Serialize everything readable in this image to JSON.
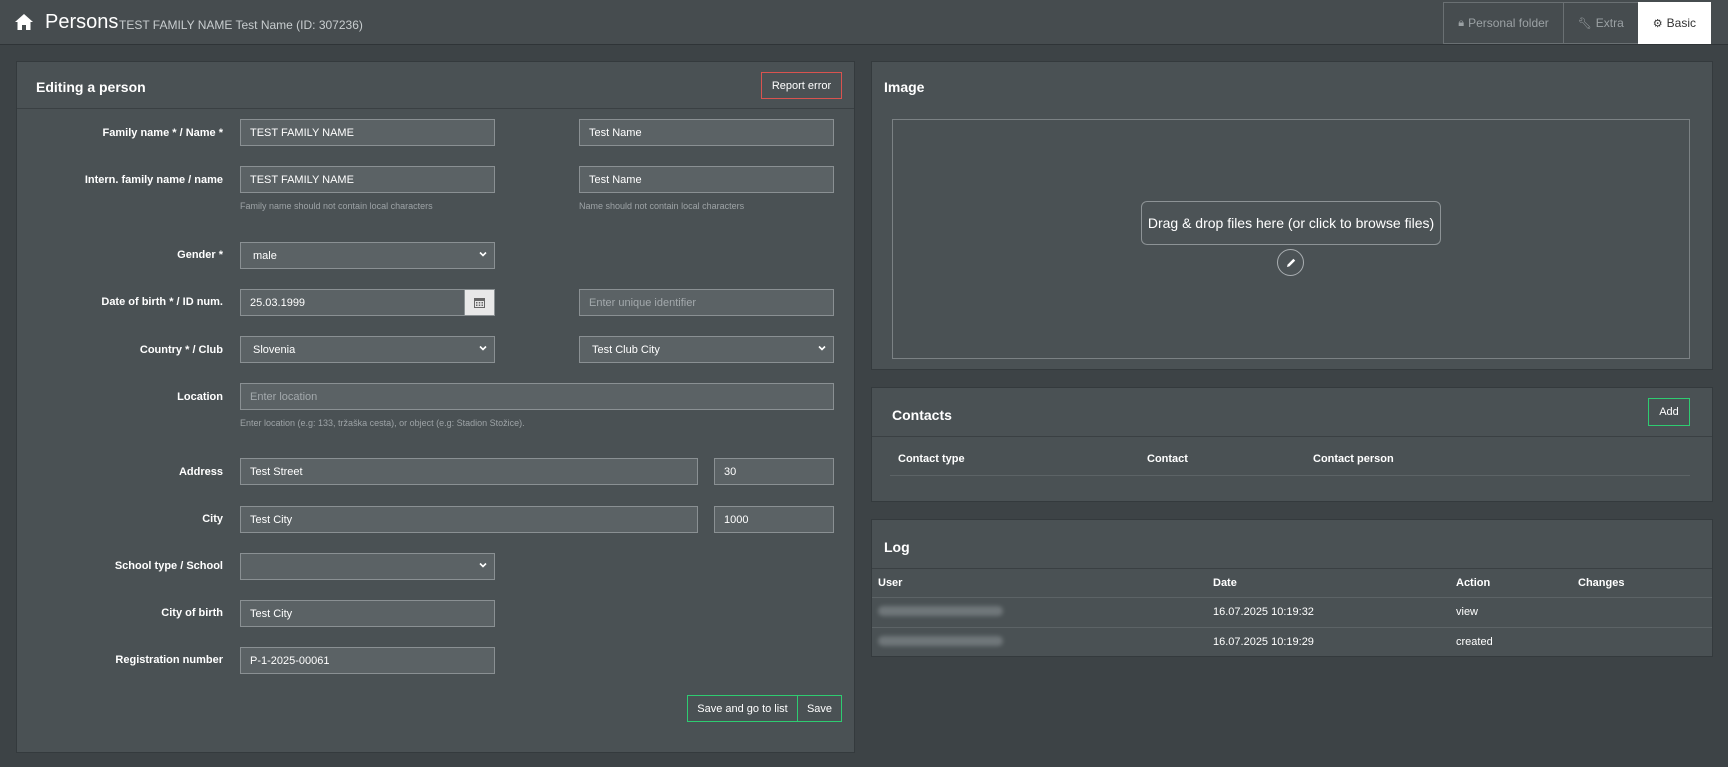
{
  "header": {
    "title": "Persons",
    "subtitle": "TEST FAMILY NAME Test Name (ID: 307236)",
    "tabs": [
      {
        "label": "Personal folder",
        "icon": "lock-icon",
        "active": false
      },
      {
        "label": "Extra",
        "icon": "wrench-icon",
        "active": false
      },
      {
        "label": "Basic",
        "icon": "gear-icon",
        "active": true
      }
    ]
  },
  "edit": {
    "title": "Editing a person",
    "report_error": "Report error",
    "labels": {
      "name": "Family name * / Name *",
      "intern_name": "Intern. family name / name",
      "gender": "Gender *",
      "dob": "Date of birth * / ID num.",
      "country": "Country * / Club",
      "location": "Location",
      "address": "Address",
      "city": "City",
      "school": "School type / School",
      "city_of_birth": "City of birth",
      "registration": "Registration number"
    },
    "values": {
      "family_name": "TEST FAMILY NAME",
      "name": "Test Name",
      "intern_family_name": "TEST FAMILY NAME",
      "intern_name": "Test Name",
      "gender": "male",
      "dob": "25.03.1999",
      "id_num": "",
      "country": "Slovenia",
      "club": "Test Club City",
      "location": "",
      "street": "Test Street",
      "house_number": "30",
      "city": "Test City",
      "postal_code": "1000",
      "school": "",
      "city_of_birth": "Test City",
      "registration": "P-1-2025-00061"
    },
    "placeholders": {
      "id_num": "Enter unique identifier",
      "location": "Enter location"
    },
    "hints": {
      "family_name": "Family name should not contain local characters",
      "name": "Name should not contain local characters",
      "location": "Enter location (e.g: 133, tržaška cesta), or object (e.g: Stadion Stožice)."
    },
    "save_and_list": "Save and go to list",
    "save": "Save"
  },
  "image": {
    "title": "Image",
    "drop_text": "Drag & drop files here (or click to browse files)"
  },
  "contacts": {
    "title": "Contacts",
    "add": "Add",
    "columns": [
      "Contact type",
      "Contact",
      "Contact person"
    ]
  },
  "log": {
    "title": "Log",
    "columns": [
      "User",
      "Date",
      "Action",
      "Changes"
    ],
    "rows": [
      {
        "date": "16.07.2025 10:19:32",
        "action": "view"
      },
      {
        "date": "16.07.2025 10:19:29",
        "action": "created"
      }
    ]
  },
  "colors": {
    "background": "#3d4346",
    "panel": "#4a5154",
    "accent_green": "#2ecc71",
    "accent_red": "#d9534f"
  }
}
